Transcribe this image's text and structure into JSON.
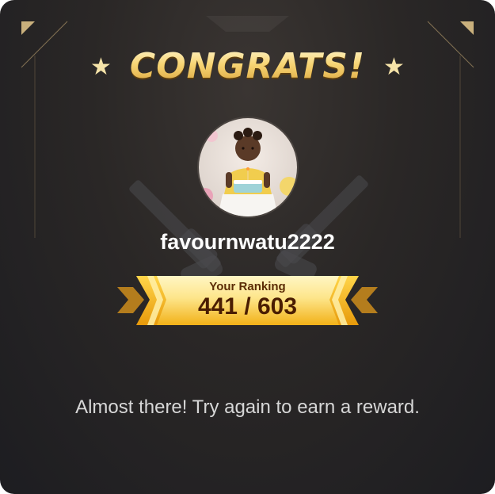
{
  "dialog": {
    "title": "CONGRATS!",
    "star_glyph": "★",
    "avatar_icon": "profile-photo-birthday-child",
    "background_icon": "crossed-guns-icon",
    "username": "favournwatu2222",
    "ranking_label": "Your Ranking",
    "ranking_value": "441 / 603",
    "rank": 441,
    "total": 603,
    "message": "Almost there! Try again to earn a reward."
  },
  "colors": {
    "gold": "#f7d574",
    "gold_dark": "#d9a23b",
    "ribbon_light": "#fff2b0",
    "ribbon_dark": "#f2b61a",
    "rank_text": "#4a1d02",
    "panel_bg": "#242325",
    "message_text": "#d7d7d7"
  }
}
